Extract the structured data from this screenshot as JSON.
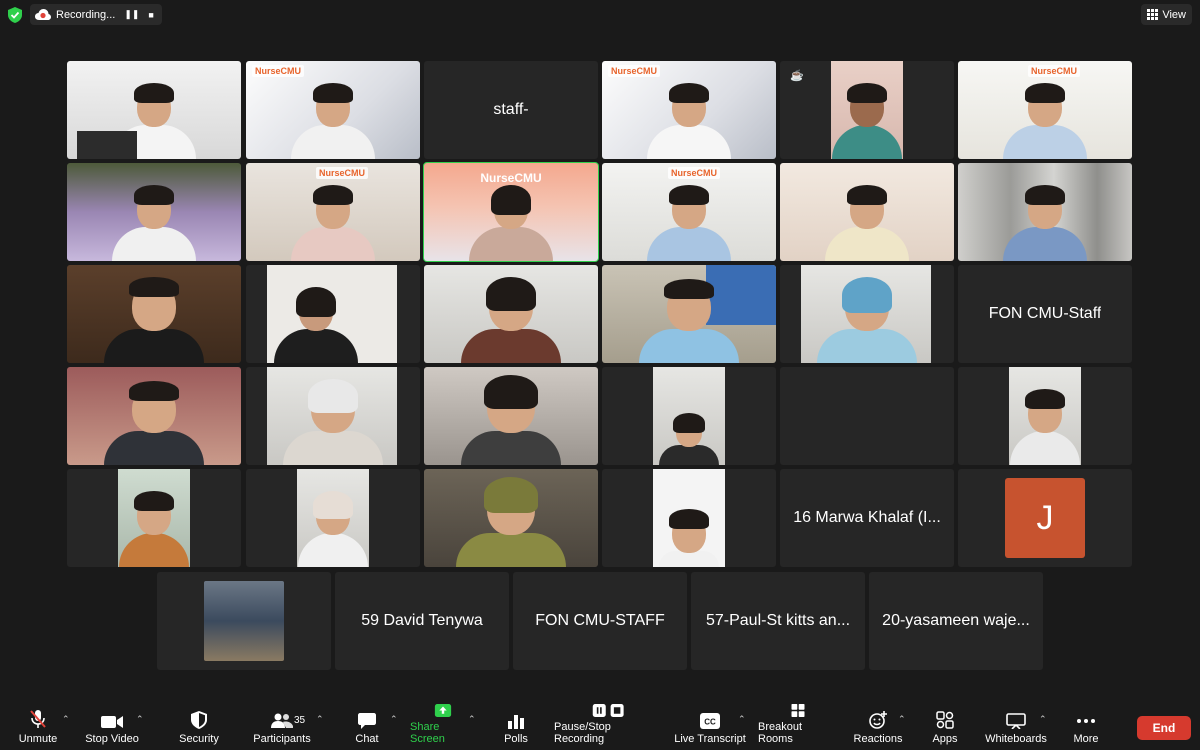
{
  "topbar": {
    "recording_label": "Recording...",
    "view_label": "View"
  },
  "tiles": [
    {
      "id": 1,
      "name": "",
      "logo": ""
    },
    {
      "id": 2,
      "name": "",
      "logo": "NurseCMU"
    },
    {
      "id": 3,
      "name": "staff-",
      "logo": ""
    },
    {
      "id": 4,
      "name": "",
      "logo": "NurseCMU"
    },
    {
      "id": 5,
      "name": "",
      "logo": ""
    },
    {
      "id": 6,
      "name": "",
      "logo": "NurseCMU"
    },
    {
      "id": 7,
      "name": "",
      "logo": ""
    },
    {
      "id": 8,
      "name": "",
      "logo": "NurseCMU"
    },
    {
      "id": 9,
      "name": "",
      "logo": "",
      "banner": "NurseCMU",
      "active": true
    },
    {
      "id": 10,
      "name": "",
      "logo": "NurseCMU"
    },
    {
      "id": 11,
      "name": "",
      "logo": ""
    },
    {
      "id": 12,
      "name": "",
      "logo": ""
    },
    {
      "id": 13,
      "name": "",
      "logo": ""
    },
    {
      "id": 14,
      "name": "",
      "logo": ""
    },
    {
      "id": 15,
      "name": "",
      "logo": ""
    },
    {
      "id": 16,
      "name": "",
      "logo": ""
    },
    {
      "id": 17,
      "name": "",
      "logo": ""
    },
    {
      "id": 18,
      "name": "FON CMU-Staff",
      "logo": ""
    },
    {
      "id": 19,
      "name": "",
      "logo": ""
    },
    {
      "id": 20,
      "name": "",
      "logo": ""
    },
    {
      "id": 21,
      "name": "",
      "logo": ""
    },
    {
      "id": 22,
      "name": "",
      "logo": ""
    },
    {
      "id": 23,
      "name": "",
      "logo": ""
    },
    {
      "id": 24,
      "name": "",
      "logo": ""
    },
    {
      "id": 25,
      "name": "",
      "logo": ""
    },
    {
      "id": 26,
      "name": "",
      "logo": ""
    },
    {
      "id": 27,
      "name": "",
      "logo": ""
    },
    {
      "id": 28,
      "name": "",
      "logo": ""
    },
    {
      "id": 29,
      "name": "16 Marwa Khalaf (I...",
      "logo": ""
    },
    {
      "id": 30,
      "name": "",
      "logo": "",
      "avatar_letter": "J"
    },
    {
      "id": 31,
      "name": "",
      "logo": ""
    },
    {
      "id": 32,
      "name": "59 David  Tenywa",
      "logo": ""
    },
    {
      "id": 33,
      "name": "FON CMU-STAFF",
      "logo": ""
    },
    {
      "id": 34,
      "name": "57-Paul-St kitts an...",
      "logo": ""
    },
    {
      "id": 35,
      "name": "20-yasameen waje...",
      "logo": ""
    }
  ],
  "toolbar": {
    "unmute": "Unmute",
    "stop_video": "Stop Video",
    "security": "Security",
    "participants": "Participants",
    "participants_count": "35",
    "chat": "Chat",
    "share_screen": "Share Screen",
    "polls": "Polls",
    "pause_stop_recording": "Pause/Stop Recording",
    "live_transcript": "Live Transcript",
    "breakout_rooms": "Breakout Rooms",
    "reactions": "Reactions",
    "apps": "Apps",
    "whiteboards": "Whiteboards",
    "more": "More",
    "end": "End"
  },
  "colors": {
    "accent_green": "#2fd04c",
    "end_red": "#d63a2e",
    "avatar_orange": "#c7532f"
  }
}
